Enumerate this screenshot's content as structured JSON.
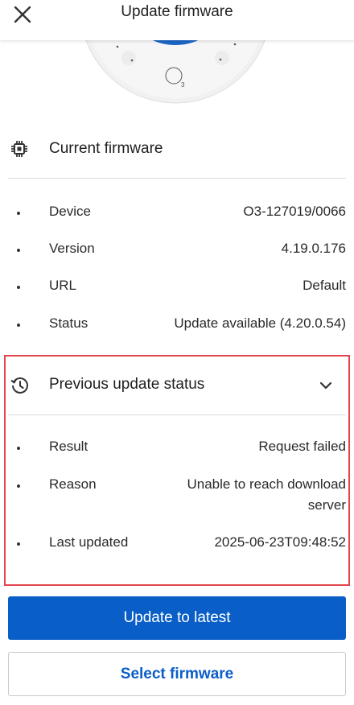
{
  "header": {
    "title": "Update firmware",
    "close_icon": "close-icon"
  },
  "device_image": {
    "model_label": "3"
  },
  "current_firmware": {
    "title": "Current firmware",
    "icon": "chip-icon",
    "rows": [
      {
        "label": "Device",
        "value": "O3-127019/0066"
      },
      {
        "label": "Version",
        "value": "4.19.0.176"
      },
      {
        "label": "URL",
        "value": "Default"
      },
      {
        "label": "Status",
        "value": "Update available (4.20.0.54)"
      }
    ]
  },
  "previous_update": {
    "title": "Previous update status",
    "icon": "history-icon",
    "expand_icon": "chevron-down-icon",
    "rows": [
      {
        "label": "Result",
        "value": "Request failed"
      },
      {
        "label": "Reason",
        "value_line1": "Unable to reach download",
        "value_line2": "server"
      },
      {
        "label": "Last updated",
        "value": "2025-06-23T09:48:52"
      }
    ]
  },
  "actions": {
    "primary_label": "Update to latest",
    "secondary_label": "Select firmware"
  },
  "colors": {
    "accent": "#0a5ec7",
    "highlight_border": "#e3454c"
  }
}
